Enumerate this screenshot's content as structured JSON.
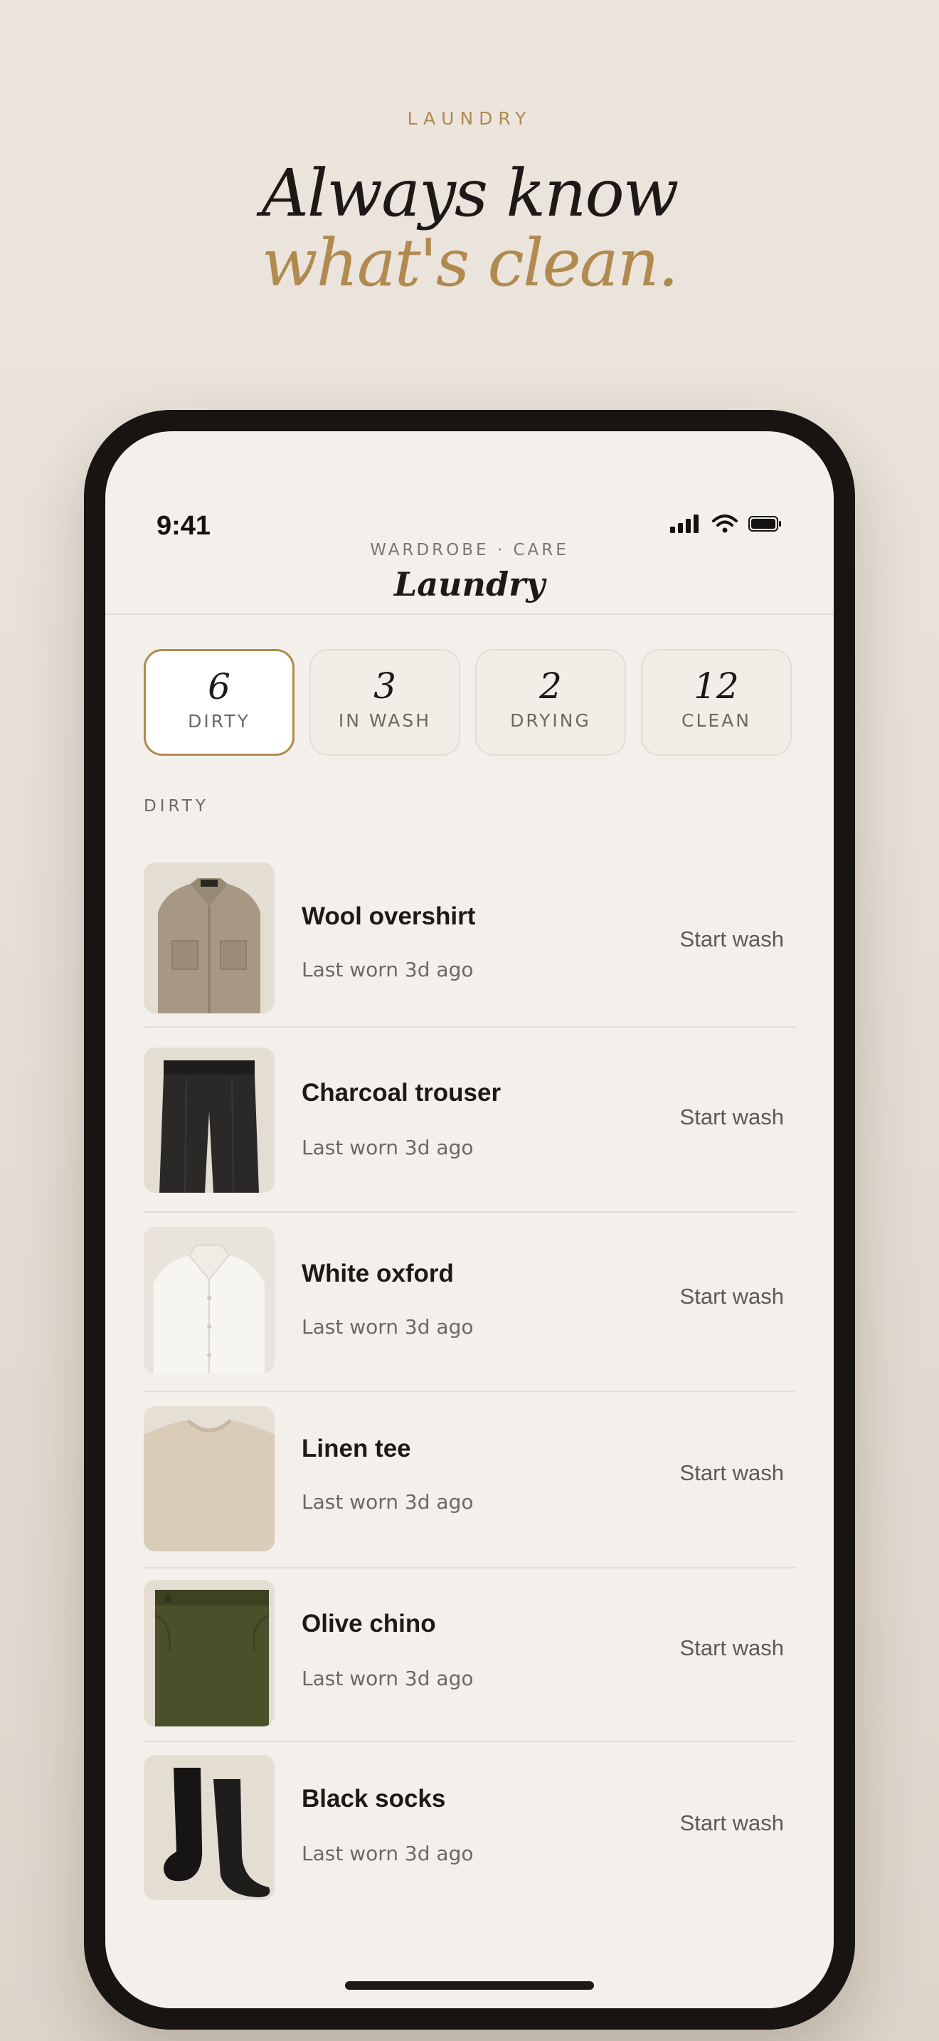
{
  "hero": {
    "eyebrow": "LAUNDRY",
    "line1": "Always know",
    "line2": "what's clean.",
    "accent_color": "#b08a4e"
  },
  "status_bar": {
    "time": "9:41",
    "icons": [
      "signal-icon",
      "wifi-icon",
      "battery-icon"
    ]
  },
  "nav": {
    "eyebrow": "WARDROBE · CARE",
    "title": "Laundry"
  },
  "stats": [
    {
      "count": "6",
      "label": "DIRTY",
      "active": true
    },
    {
      "count": "3",
      "label": "IN WASH",
      "active": false
    },
    {
      "count": "2",
      "label": "DRYING",
      "active": false
    },
    {
      "count": "12",
      "label": "CLEAN",
      "active": false
    }
  ],
  "section": {
    "label": "DIRTY"
  },
  "items": [
    {
      "name": "Wool overshirt",
      "subtitle": "Last worn 3d ago",
      "action": "Start wash",
      "thumb": "wool-overshirt-photo"
    },
    {
      "name": "Charcoal trouser",
      "subtitle": "Last worn 3d ago",
      "action": "Start wash",
      "thumb": "charcoal-trouser-photo"
    },
    {
      "name": "White oxford",
      "subtitle": "Last worn 3d ago",
      "action": "Start wash",
      "thumb": "white-oxford-photo"
    },
    {
      "name": "Linen tee",
      "subtitle": "Last worn 3d ago",
      "action": "Start wash",
      "thumb": "linen-tee-photo"
    },
    {
      "name": "Olive chino",
      "subtitle": "Last worn 3d ago",
      "action": "Start wash",
      "thumb": "olive-chino-photo"
    },
    {
      "name": "Black socks",
      "subtitle": "Last worn 3d ago",
      "action": "Start wash",
      "thumb": "black-socks-photo"
    }
  ]
}
